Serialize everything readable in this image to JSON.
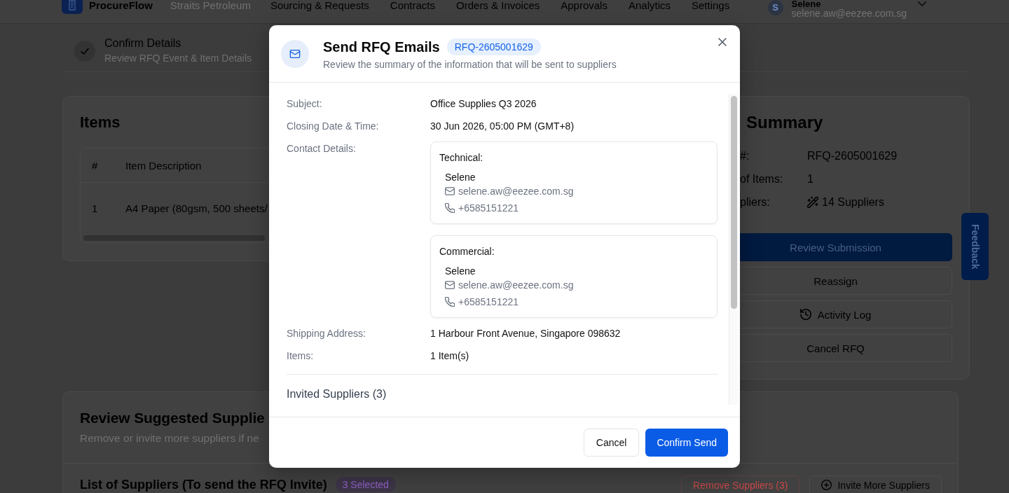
{
  "app_header": {
    "brand": "ProcureFlow",
    "company": "Straits Petroleum",
    "nav": [
      "Sourcing & Requests",
      "Contracts",
      "Orders & Invoices",
      "Approvals",
      "Analytics",
      "Settings"
    ],
    "user": {
      "initial": "S",
      "name": "Selene",
      "email": "selene.aw@eezee.com.sg"
    }
  },
  "stepper": {
    "steps": [
      {
        "title": "Confirm Details",
        "subtitle": "Review RFQ Event & Item Details",
        "completed": true
      }
    ]
  },
  "items_card": {
    "title": "Items",
    "columns": [
      "#",
      "Item Description"
    ],
    "rows": [
      {
        "number": "1",
        "description": "A4 Paper (80gsm, 500 sheets/"
      }
    ]
  },
  "summary_card": {
    "title": "Summary",
    "rfq_number": {
      "label": "#:",
      "value": "RFQ-2605001629"
    },
    "item_count": {
      "label": "of Items:",
      "value": "1"
    },
    "suppliers": {
      "label": "pliers:",
      "value": "14 Suppliers"
    },
    "review_button": "Review Submission",
    "reassign_button": "Reassign",
    "activity_log_button": "Activity Log",
    "cancel_button": "Cancel RFQ"
  },
  "feedback_tab": "Feedback",
  "suppliers_card": {
    "title": "Review Suggested Supplie",
    "subtitle": "Remove or invite more suppliers if ne",
    "list_title": "List of Suppliers (To send the RFQ Invite)",
    "selected_badge": "3 Selected",
    "remove_button": "Remove Suppliers (3)",
    "invite_button": "Invite More Suppliers"
  },
  "modal": {
    "title": "Send RFQ Emails",
    "badge": "RFQ-2605001629",
    "subtitle": "Review the summary of the information that will be sent to suppliers",
    "fields": [
      {
        "kind": "text",
        "label": "Subject:",
        "value": "Office Supplies Q3 2026"
      },
      {
        "kind": "text",
        "label": "Closing Date & Time:",
        "value": "30 Jun 2026, 05:00 PM (GMT+8)"
      },
      {
        "kind": "contacts",
        "label": "Contact Details:",
        "contacts": [
          {
            "role": "Technical:",
            "name": "Selene",
            "email": "selene.aw@eezee.com.sg",
            "phone": "+6585151221"
          },
          {
            "role": "Commercial:",
            "name": "Selene",
            "email": "selene.aw@eezee.com.sg",
            "phone": "+6585151221"
          }
        ]
      },
      {
        "kind": "text",
        "label": "Shipping Address:",
        "value": "1 Harbour Front Avenue, Singapore 098632"
      },
      {
        "kind": "text",
        "label": "Items:",
        "value": "1 Item(s)"
      }
    ],
    "section_title": "Invited Suppliers (3)",
    "cancel_button": "Cancel",
    "confirm_button": "Confirm Send"
  }
}
